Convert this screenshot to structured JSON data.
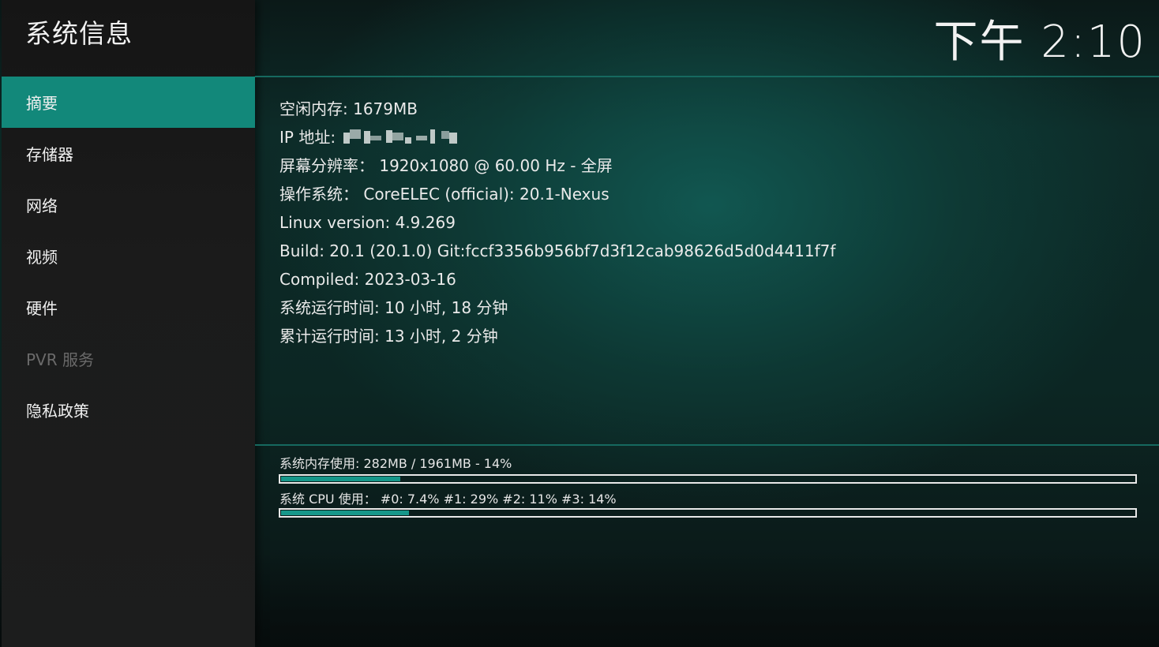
{
  "header": {
    "title": "系统信息",
    "clock": "下午 2:10"
  },
  "sidebar": {
    "items": [
      {
        "label": "摘要",
        "state": "active"
      },
      {
        "label": "存储器",
        "state": "normal"
      },
      {
        "label": "网络",
        "state": "normal"
      },
      {
        "label": "视频",
        "state": "normal"
      },
      {
        "label": "硬件",
        "state": "normal"
      },
      {
        "label": "PVR 服务",
        "state": "disabled"
      },
      {
        "label": "隐私政策",
        "state": "normal"
      }
    ]
  },
  "summary": {
    "free_memory": "空闲内存: 1679MB",
    "ip_label": "IP 地址:",
    "resolution": "屏幕分辨率： 1920x1080 @ 60.00 Hz - 全屏",
    "os": "操作系统： CoreELEC (official): 20.1-Nexus",
    "linux_version": "Linux version: 4.9.269",
    "build": "Build: 20.1 (20.1.0) Git:fccf3356b956bf7d3f12cab98626d5d0d4411f7f",
    "compiled": "Compiled: 2023-03-16",
    "uptime": "系统运行时间: 10 小时, 18 分钟",
    "total_uptime": "累计运行时间: 13 小时, 2 分钟"
  },
  "usage": {
    "memory_label": "系统内存使用: 282MB / 1961MB - 14%",
    "memory_fraction": 0.14,
    "cpu_label": "系统 CPU 使用： #0: 7.4% #1:  29% #2:  11% #3:  14%",
    "cpu_fraction": 0.15
  },
  "colors": {
    "accent": "#12887a",
    "bar_fill": "#16978a",
    "divider": "#16695f"
  }
}
